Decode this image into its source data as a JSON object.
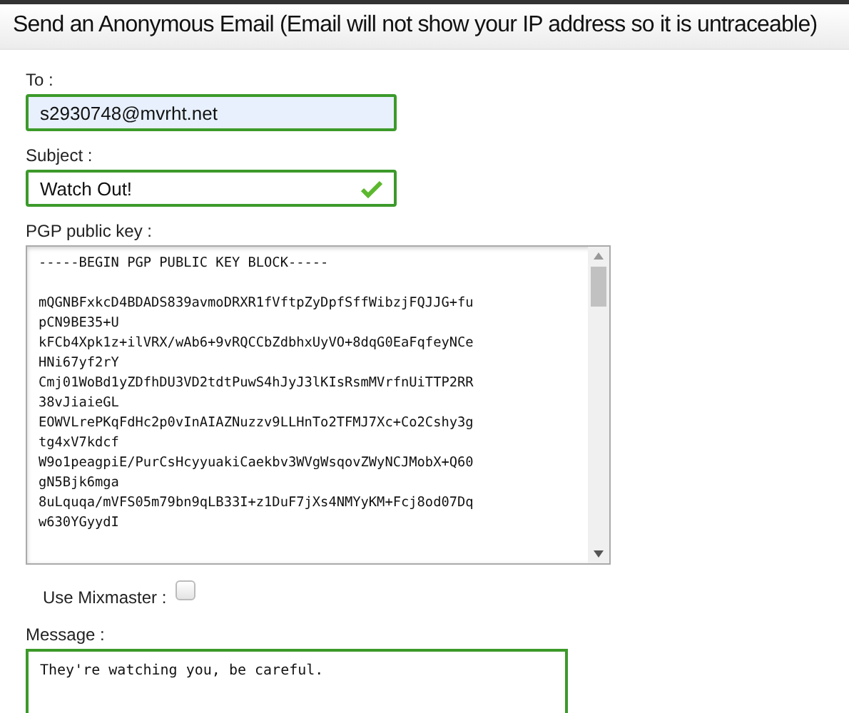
{
  "header": {
    "title": "Send an Anonymous Email (Email will not show your IP address so it is untraceable)"
  },
  "fields": [
    {
      "label": "To :",
      "value": "s2930748@mvrht.net",
      "valid": true,
      "autofilled": true,
      "check_mark": false
    },
    {
      "label": "Subject :",
      "value": "Watch Out!",
      "valid": true,
      "autofilled": false,
      "check_mark": true
    }
  ],
  "pgp": {
    "label": "PGP public key :",
    "header_line": "-----BEGIN PGP PUBLIC KEY BLOCK-----",
    "lines": [
      "mQGNBFxkcD4BDADS839avmoDRXR1fVftpZyDpfSffWibzjFQJJG+fu",
      "pCN9BE35+U",
      "kFCb4Xpk1z+ilVRX/wAb6+9vRQCCbZdbhxUyVO+8dqG0EaFqfeyNCe",
      "HNi67yf2rY",
      "Cmj01WoBd1yZDfhDU3VD2tdtPuwS4hJyJ3lKIsRsmMVrfnUiTTP2RR",
      "38vJiaieGL",
      "EOWVLrePKqFdHc2p0vInAIAZNuzzv9LLHnTo2TFMJ7Xc+Co2Cshy3g",
      "tg4xV7kdcf",
      "W9o1peagpiE/PurCsHcyyuakiCaekbv3WVgWsqovZWyNCJMobX+Q60",
      "gN5Bjk6mga",
      "8uLquqa/mVFS05m79bn9qLB33I+z1DuF7jXs4NMYyKM+Fcj8od07Dq",
      "w630YGyydI"
    ]
  },
  "mixmaster": {
    "label": "Use Mixmaster :",
    "checked": false
  },
  "message": {
    "label": "Message :",
    "value": "They're watching you, be careful.",
    "valid": true
  }
}
